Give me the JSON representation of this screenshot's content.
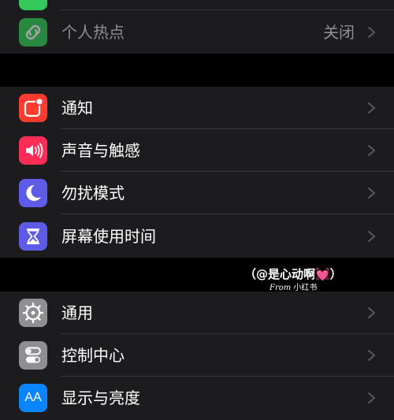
{
  "top_group": {
    "hotspot": {
      "label": "个人热点",
      "value": "关闭",
      "icon": "link-chain-icon",
      "color": "#30d158"
    },
    "partial_icon_color": "#34c759"
  },
  "notifications_group": {
    "items": [
      {
        "label": "通知",
        "icon": "notification-badge-icon",
        "color": "#ff3b30"
      },
      {
        "label": "声音与触感",
        "icon": "speaker-icon",
        "color": "#ff2d55"
      },
      {
        "label": "勿扰模式",
        "icon": "moon-icon",
        "color": "#5e5ce6"
      },
      {
        "label": "屏幕使用时间",
        "icon": "hourglass-icon",
        "color": "#5e5ce6"
      }
    ]
  },
  "general_group": {
    "items": [
      {
        "label": "通用",
        "icon": "gear-icon",
        "color": "#8e8e93"
      },
      {
        "label": "控制中心",
        "icon": "toggle-switches-icon",
        "color": "#8e8e93"
      },
      {
        "label": "显示与亮度",
        "icon": "text-size-icon",
        "color": "#0a84ff",
        "glyph": "AA"
      }
    ]
  },
  "watermark": {
    "handle": "（@是心动啊",
    "heart": "💓",
    "close": "）",
    "from": "From",
    "source": "小红书"
  }
}
